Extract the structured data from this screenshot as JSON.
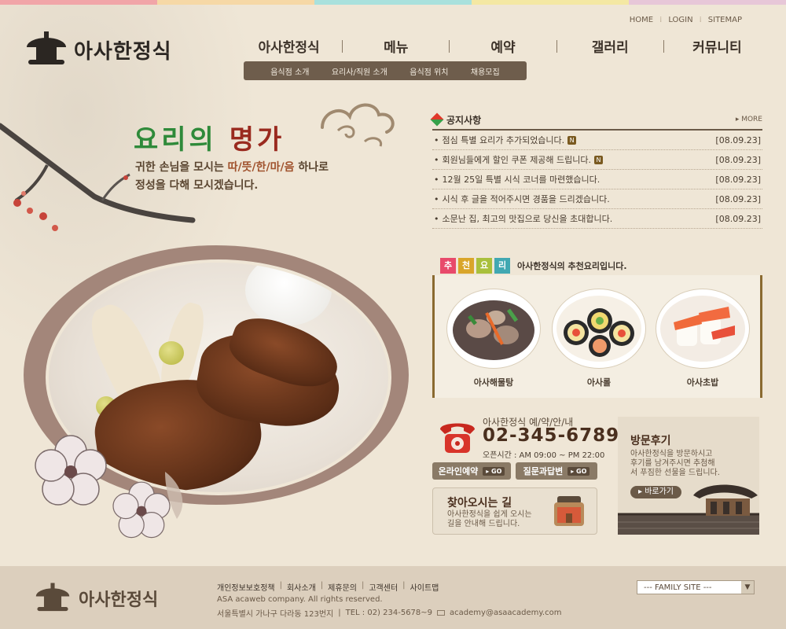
{
  "colors": {
    "strip": [
      "#f1a5a8",
      "#f6d8a6",
      "#a9e1dd",
      "#f4e8a3",
      "#e7c7d8"
    ],
    "rec_tags": [
      "#e84a6b",
      "#d9a52a",
      "#a9c03c",
      "#41a8b2"
    ]
  },
  "util_nav": {
    "home": "HOME",
    "login": "LOGIN",
    "sitemap": "SITEMAP"
  },
  "logo": {
    "text": "아사한정식"
  },
  "gnb": [
    "아사한정식",
    "메뉴",
    "예약",
    "갤러리",
    "커뮤니티"
  ],
  "subnav": [
    "음식점 소개",
    "요리사/직원 소개",
    "음식점 위치",
    "채용모집"
  ],
  "hero": {
    "title_1": "요리의",
    "title_2": "명가",
    "sub_1a": "귀한 손님을 모시는 ",
    "sub_1b": "따/뜻/한/마/음",
    "sub_1c": " 하나로",
    "sub_2": "정성을 다해 모시겠습니다."
  },
  "notice": {
    "title": "공지사항",
    "more": "MORE",
    "items": [
      {
        "text": "점심 특별 요리가 추가되었습니다.",
        "date": "[08.09.23]",
        "new": "N"
      },
      {
        "text": "회원님들에게 할인 쿠폰 제공해 드립니다.",
        "date": "[08.09.23]",
        "new": "N"
      },
      {
        "text": "12월 25일 특별 시식 코너를 마련했습니다.",
        "date": "[08.09.23]"
      },
      {
        "text": "시식 후 글을 적어주시면 경품을 드리겠습니다.",
        "date": "[08.09.23]"
      },
      {
        "text": "소문난 집, 최고의 맛집으로 당신을 초대합니다.",
        "date": "[08.09.23]"
      }
    ]
  },
  "recommend": {
    "tags": [
      "추",
      "천",
      "요",
      "리"
    ],
    "desc": "아사한정식의 추천요리입니다.",
    "items": [
      {
        "label": "아사해물탕"
      },
      {
        "label": "아사롤"
      },
      {
        "label": "아사초밥"
      }
    ]
  },
  "reservation": {
    "title": "아사한정식 예/약/안/내",
    "phone": "02-345-6789",
    "hours": "오픈시간 : AM 09:00 ~ PM 22:00",
    "btn_online": "온라인예약",
    "btn_qna": "질문과답변",
    "go": "GO"
  },
  "directions": {
    "title": "찾아오시는 길",
    "desc_1": "아사한정식을 쉽게 오시는",
    "desc_2": "길을 안내해 드립니다."
  },
  "review": {
    "title": "방문후기",
    "desc_1": "아사한정식을 방문하시고",
    "desc_2": "후기를 남겨주시면 추첨해",
    "desc_3": "서 푸짐한 선물을 드립니다.",
    "btn": "바로가기"
  },
  "footer": {
    "logo": "아사한정식",
    "links": [
      "개인정보보호정책",
      "회사소개",
      "제휴문의",
      "고객센터",
      "사이트맵"
    ],
    "copyright": "ASA acaweb company. All rights reserved.",
    "address": "서울특별시 가나구 다라동 123번지",
    "tel": "TEL : 02) 234-5678~9",
    "email": "academy@asaacademy.com",
    "family_site": "--- FAMILY SITE ---",
    "family_arrow": "▼"
  }
}
